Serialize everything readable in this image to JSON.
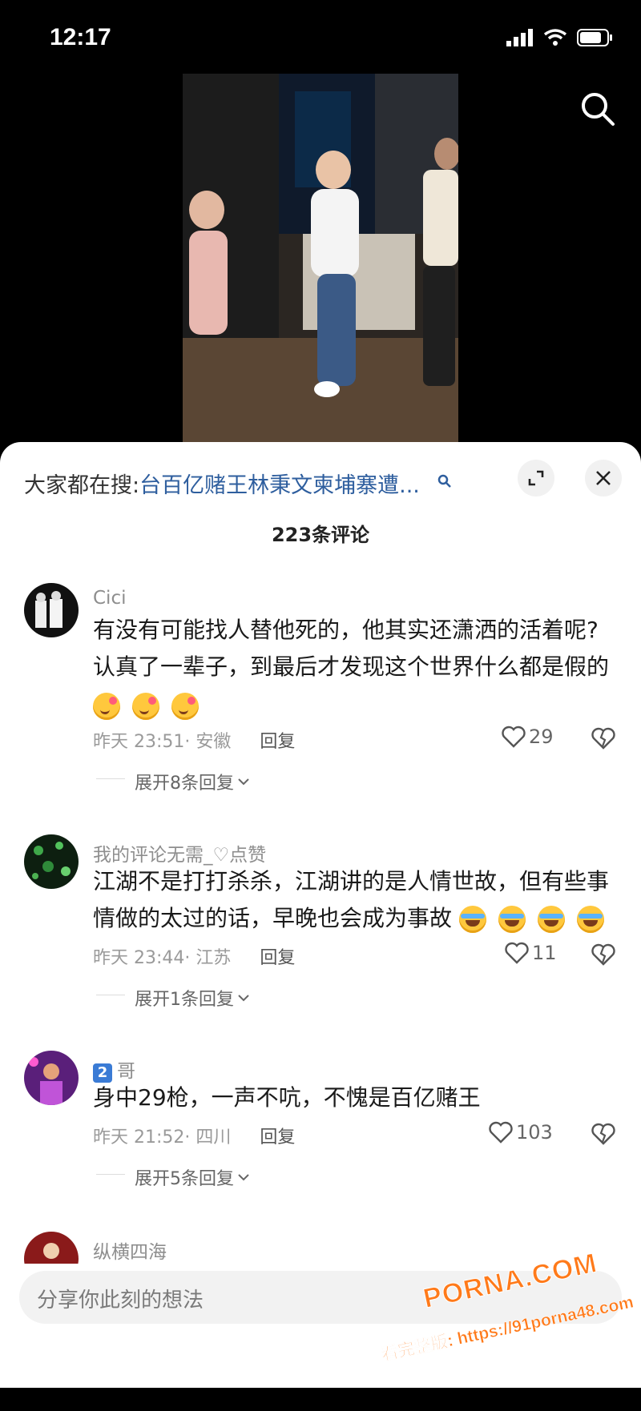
{
  "status": {
    "time": "12:17"
  },
  "hot_search": {
    "prefix": "大家都在搜:",
    "query": "台百亿赌王林秉文柬埔寨遭..."
  },
  "comment_count": "223条评论",
  "comments": [
    {
      "user": "Cici",
      "text_line1": "有没有可能找人替他死的，他其实还潇洒的活着呢?",
      "text_line2": "认真了一辈子，到最后才发现这个世界什么都是假的",
      "time": "昨天 23:51",
      "location": "· 安徽",
      "reply": "回复",
      "likes": "29",
      "expand": "展开8条回复"
    },
    {
      "user": "我的评论无需_♡点赞",
      "text_line1": "江湖不是打打杀杀，江湖讲的是人情世故，但有些事",
      "text_line2": "情做的太过的话，早晚也会成为事故",
      "time": "昨天 23:44",
      "location": "· 江苏",
      "reply": "回复",
      "likes": "11",
      "expand": "展开1条回复"
    },
    {
      "user_badge": "2",
      "user": "哥",
      "text_line1": "身中29枪，一声不吭，不愧是百亿赌王",
      "time": "昨天 21:52",
      "location": "· 四川",
      "reply": "回复",
      "likes": "103",
      "expand": "展开5条回复"
    },
    {
      "user": "纵横四海"
    }
  ],
  "input": {
    "placeholder": "分享你此刻的想法"
  },
  "watermark": {
    "line1": "PORNA.COM",
    "line2": "看完整版: https://91porna48.com"
  },
  "colors": {
    "link": "#2e5e9e",
    "accent_watermark": "#ff7a1a"
  }
}
